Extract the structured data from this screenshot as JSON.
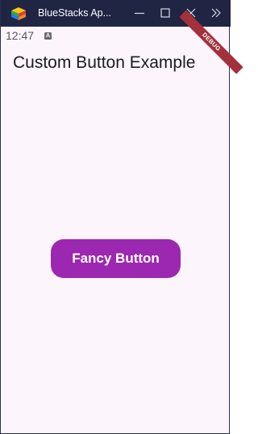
{
  "window": {
    "title": "BlueStacks Ap...",
    "app_icon": "bluestacks-logo-icon",
    "controls": [
      "minimize-icon",
      "maximize-icon",
      "close-icon",
      "expand-sidebar-icon"
    ]
  },
  "status_bar": {
    "time": "12:47",
    "notification_icon_text": "A"
  },
  "debug_banner": "DEBUG",
  "app": {
    "title": "Custom Button Example",
    "fancy_button_label": "Fancy Button"
  },
  "colors": {
    "titlebar": "#1f2543",
    "background": "#fcf5fb",
    "button": "#9c27b0",
    "debug_banner": "#a3303a"
  }
}
